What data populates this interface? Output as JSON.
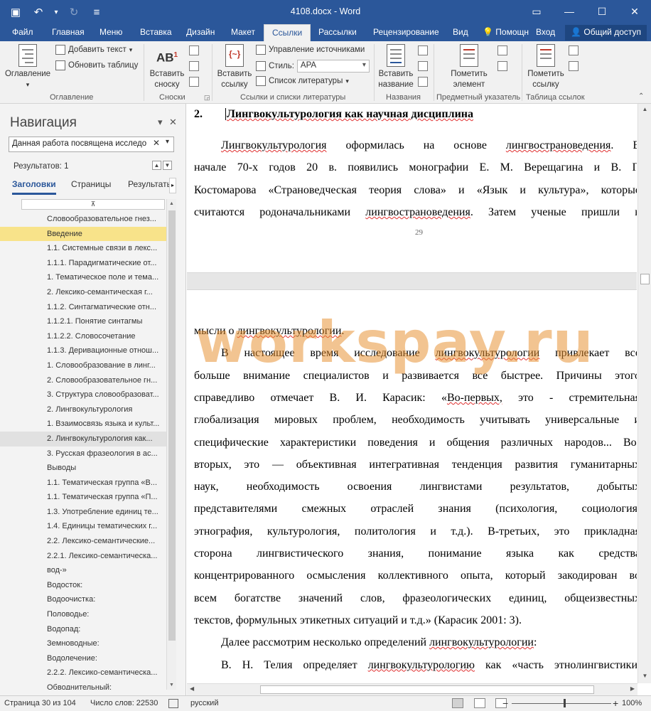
{
  "window": {
    "title": "4108.docx - Word",
    "controls": {
      "options": "▭",
      "minimize": "—",
      "maximize": "☐",
      "close": "✕"
    }
  },
  "qat": {
    "save": "▣",
    "undo": "↶",
    "undo_more": "▾",
    "redo": "↻",
    "customize": "≡"
  },
  "tabs": [
    "Файл",
    "Главная",
    "Меню",
    "Вставка",
    "Дизайн",
    "Макет",
    "Ссылки",
    "Рассылки",
    "Рецензирование",
    "Вид"
  ],
  "active_tab": "Ссылки",
  "tab_extras": {
    "tell_me": "Помощн",
    "sign_in": "Вход",
    "share": "Общий доступ"
  },
  "ribbon": {
    "toc": {
      "label": "Оглавление",
      "add_text": "Добавить текст",
      "update_table": "Обновить таблицу",
      "group": "Оглавление"
    },
    "footnotes": {
      "insert_footnote_line1": "Вставить",
      "insert_footnote_line2": "сноску",
      "ab_label": "AB",
      "group": "Сноски"
    },
    "citations": {
      "insert_citation_line1": "Вставить",
      "insert_citation_line2": "ссылку",
      "manage_sources": "Управление источниками",
      "style_label": "Стиль:",
      "style_value": "APA",
      "bibliography": "Список литературы",
      "group": "Ссылки и списки литературы"
    },
    "captions": {
      "insert_caption_line1": "Вставить",
      "insert_caption_line2": "название",
      "group": "Названия"
    },
    "index": {
      "mark_entry_line1": "Пометить",
      "mark_entry_line2": "элемент",
      "group": "Предметный указатель"
    },
    "authorities": {
      "mark_citation_line1": "Пометить",
      "mark_citation_line2": "ссылку",
      "group": "Таблица ссылок"
    }
  },
  "nav": {
    "title": "Навигация",
    "close": "✕",
    "menu": "▾",
    "search_value": "Данная работа посвящена исследо",
    "search_clear": "✕",
    "search_dropdown": "▾",
    "results": "Результатов: 1",
    "prev": "▲",
    "next": "▼",
    "tabs": [
      "Заголовки",
      "Страницы",
      "Результать"
    ],
    "tab_scroll": "▸",
    "collapse_marker": "⊼",
    "headings": [
      {
        "text": "Словообразовательное гнез...",
        "indent": 1,
        "state": ""
      },
      {
        "text": "Введение",
        "indent": 1,
        "state": "sel"
      },
      {
        "text": "1.1. Системные связи в лекс...",
        "indent": 1,
        "state": ""
      },
      {
        "text": "1.1.1. Парадигматические от...",
        "indent": 1,
        "state": ""
      },
      {
        "text": "1. Тематическое поле и тема...",
        "indent": 1,
        "state": ""
      },
      {
        "text": "2. Лексико-семантическая г...",
        "indent": 1,
        "state": ""
      },
      {
        "text": "1.1.2. Синтагматические отн...",
        "indent": 1,
        "state": ""
      },
      {
        "text": "1.1.2.1. Понятие синтагмы",
        "indent": 1,
        "state": ""
      },
      {
        "text": "1.1.2.2. Словосочетание",
        "indent": 1,
        "state": ""
      },
      {
        "text": "1.1.3. Деривационные отнош...",
        "indent": 1,
        "state": ""
      },
      {
        "text": "1. Словообразование в линг...",
        "indent": 1,
        "state": ""
      },
      {
        "text": "2. Словообразовательное гн...",
        "indent": 1,
        "state": ""
      },
      {
        "text": "3. Структура словообразоват...",
        "indent": 1,
        "state": ""
      },
      {
        "text": "2. Лингвокультурология",
        "indent": 1,
        "state": ""
      },
      {
        "text": "1. Взаимосвязь языка и культ...",
        "indent": 1,
        "state": ""
      },
      {
        "text": "2. Лингвокультурология как...",
        "indent": 1,
        "state": "cur"
      },
      {
        "text": "3. Русская фразеология в ас...",
        "indent": 1,
        "state": ""
      },
      {
        "text": "Выводы",
        "indent": 1,
        "state": ""
      },
      {
        "text": "1.1. Тематическая группа «В...",
        "indent": 1,
        "state": ""
      },
      {
        "text": "1.1. Тематическая группа «П...",
        "indent": 1,
        "state": ""
      },
      {
        "text": "1.3. Употребление единиц те...",
        "indent": 1,
        "state": ""
      },
      {
        "text": "1.4. Единицы тематических г...",
        "indent": 1,
        "state": ""
      },
      {
        "text": "2.2. Лексико-семантические...",
        "indent": 1,
        "state": ""
      },
      {
        "text": "2.2.1. Лексико-семантическа...",
        "indent": 1,
        "state": ""
      },
      {
        "text": "вод-»",
        "indent": 1,
        "state": ""
      },
      {
        "text": "Водосток:",
        "indent": 1,
        "state": ""
      },
      {
        "text": "Водоочистка:",
        "indent": 1,
        "state": ""
      },
      {
        "text": "Половодье:",
        "indent": 1,
        "state": ""
      },
      {
        "text": "Водопад:",
        "indent": 1,
        "state": ""
      },
      {
        "text": "Земноводные:",
        "indent": 1,
        "state": ""
      },
      {
        "text": "Водолечение:",
        "indent": 1,
        "state": ""
      },
      {
        "text": "2.2.2. Лексико-семантическа...",
        "indent": 1,
        "state": ""
      },
      {
        "text": "Обводнительный:",
        "indent": 1,
        "state": ""
      }
    ]
  },
  "document": {
    "heading_num": "2.",
    "heading_text": "Лингвокультурология как научная дисциплина",
    "page1_lines": [
      "Лингвокультурология оформилась на основе лингвострановедения. В",
      "начале 70-х годов 20 в. появились монографии Е. М. Верещагина и В. Г.",
      "Костомарова «Страноведческая теория слова» и «Язык и культура», которые",
      "считаются родоначальниками лингвострановедения. Затем ученые пришли к"
    ],
    "page_number": "29",
    "page2_lines": [
      "мысли о лингвокультурологии.",
      "В настоящее время исследование лингвокультурологии привлекает все",
      "больше внимание специалистов и развивается все быстрее. Причины этого",
      "справедливо отмечает В. И. Карасик: «Во-первых, это - стремительная",
      "глобализация мировых проблем, необходимость учитывать универсальные и",
      "специфические характеристики поведения и общения различных народов... Во-",
      "вторых, это — объективная интегративная тенденция развития гуманитарных",
      "наук, необходимость освоения лингвистами результатов, добытых",
      "представителями смежных отраслей знания (психология, социология,",
      "этнография, культурология, политология и т.д.). В-третьих, это прикладная",
      "сторона лингвистического знания, понимание языка как средства",
      "концентрированного осмысления коллективного опыта, который закодирован во",
      "всем богатстве значений слов, фразеологических единиц, общеизвестных",
      "текстов, формульных этикетных ситуаций и т.д.» (Карасик 2001: 3).",
      "Далее рассмотрим несколько определений лингвокультурологии:",
      "В. Н. Телия определяет лингвокультурологию как «часть этнолингвистики,"
    ],
    "watermark": "workspay.ru"
  },
  "status": {
    "page": "Страница 30 из 104",
    "words": "Число слов: 22530",
    "language": "русский",
    "zoom": "100%",
    "zoom_minus": "−",
    "zoom_plus": "+",
    "zoom_level": 0.53
  },
  "colors": {
    "accent": "#2b579a",
    "highlight": "#f8e38a",
    "watermark": "#e78e2d",
    "spell": "#e03030"
  }
}
